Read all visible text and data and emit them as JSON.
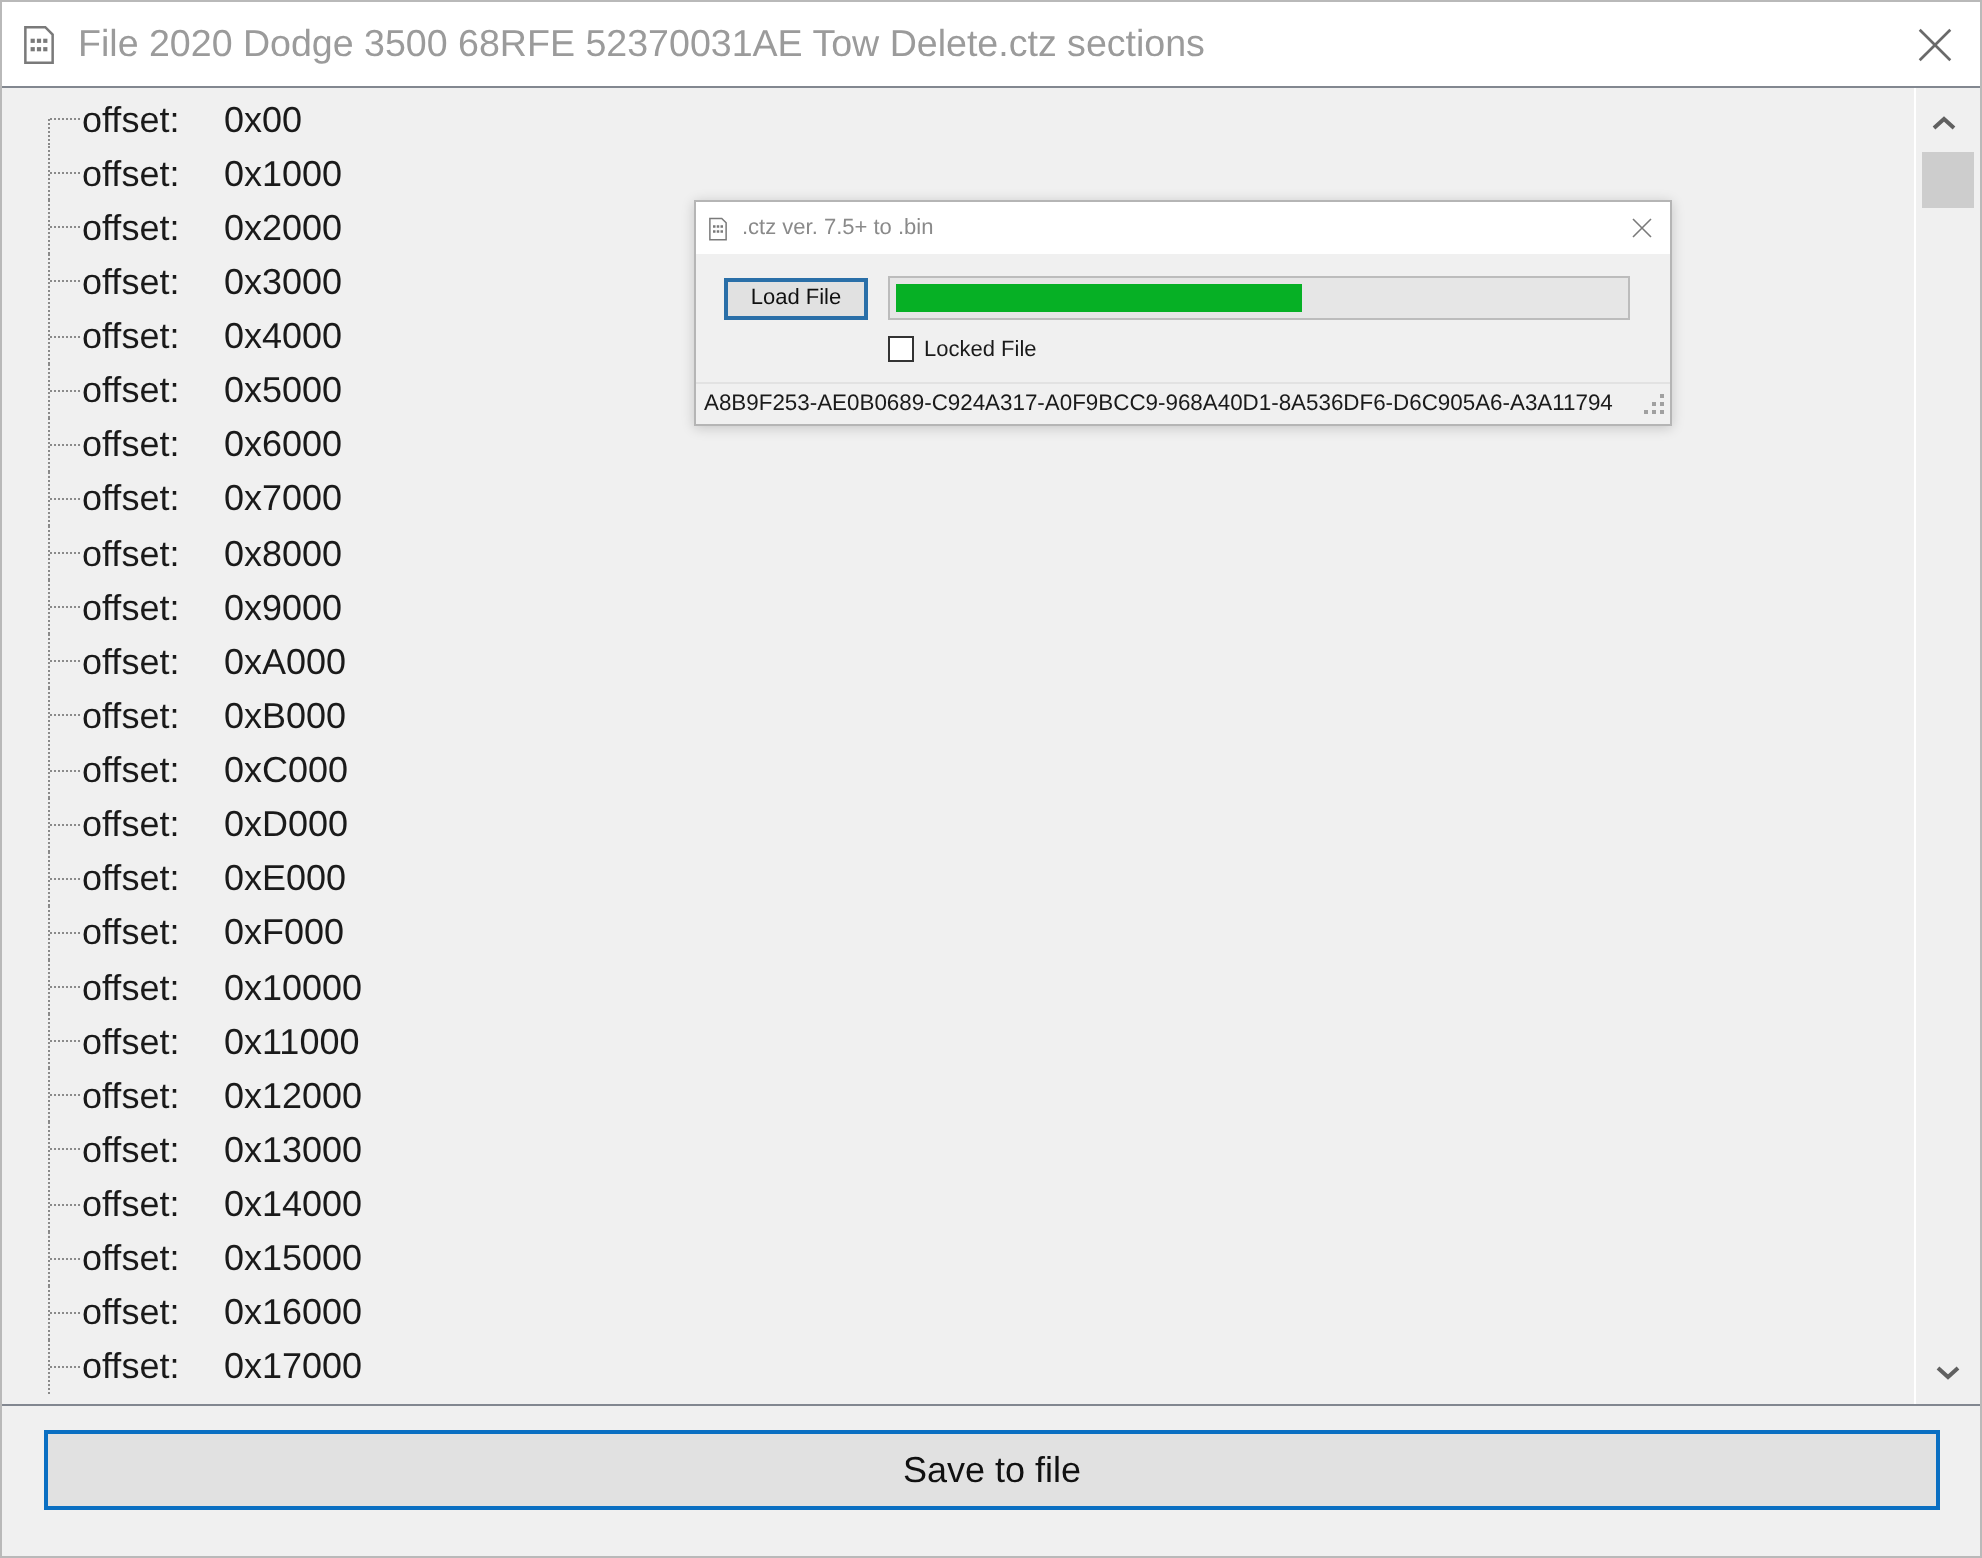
{
  "window": {
    "title": "File 2020 Dodge 3500 68RFE 52370031AE Tow Delete.ctz sections"
  },
  "tree": {
    "items": [
      {
        "label": "offset:",
        "value": "0x00",
        "selected": false
      },
      {
        "label": "offset:",
        "value": "0x1000",
        "selected": false
      },
      {
        "label": "offset:",
        "value": "0x2000",
        "selected": false
      },
      {
        "label": "offset:",
        "value": "0x3000",
        "selected": false
      },
      {
        "label": "offset:",
        "value": "0x4000",
        "selected": false
      },
      {
        "label": "offset:",
        "value": "0x5000",
        "selected": false
      },
      {
        "label": "offset:",
        "value": "0x6000",
        "selected": false
      },
      {
        "label": "offset:",
        "value": "0x7000",
        "selected": false
      },
      {
        "label": "offset:",
        "value": "0x8000",
        "selected": false
      },
      {
        "label": "offset:",
        "value": "0x9000",
        "selected": false
      },
      {
        "label": "offset:",
        "value": "0xA000",
        "selected": false
      },
      {
        "label": "offset:",
        "value": "0xB000",
        "selected": false
      },
      {
        "label": "offset:",
        "value": "0xC000",
        "selected": false
      },
      {
        "label": "offset:",
        "value": "0xD000",
        "selected": false
      },
      {
        "label": "offset:",
        "value": "0xE000",
        "selected": false
      },
      {
        "label": "offset:",
        "value": "0xF000",
        "selected": false
      },
      {
        "label": "offset:",
        "value": "0x10000",
        "selected": false
      },
      {
        "label": "offset:",
        "value": "0x11000",
        "selected": false
      },
      {
        "label": "offset:",
        "value": "0x12000",
        "selected": false
      },
      {
        "label": "offset:",
        "value": "0x13000",
        "selected": false
      },
      {
        "label": "offset:",
        "value": "0x14000",
        "selected": false
      },
      {
        "label": "offset:",
        "value": "0x15000",
        "selected": false
      },
      {
        "label": "offset:",
        "value": "0x16000",
        "selected": false
      },
      {
        "label": "offset:",
        "value": "0x17000",
        "selected": false
      }
    ]
  },
  "save_button": {
    "label": "Save to file"
  },
  "dialog": {
    "title": ".ctz ver. 7.5+ to .bin",
    "load_button": {
      "label": "Load File"
    },
    "progress": {
      "level": 0.56
    },
    "locked_checkbox": {
      "label": "Locked File",
      "checked": false
    },
    "status_text": "A8B9F253-AE0B0689-C924A317-A0F9BCC9-968A40D1-8A536DF6-D6C905A6-A3A11794"
  }
}
